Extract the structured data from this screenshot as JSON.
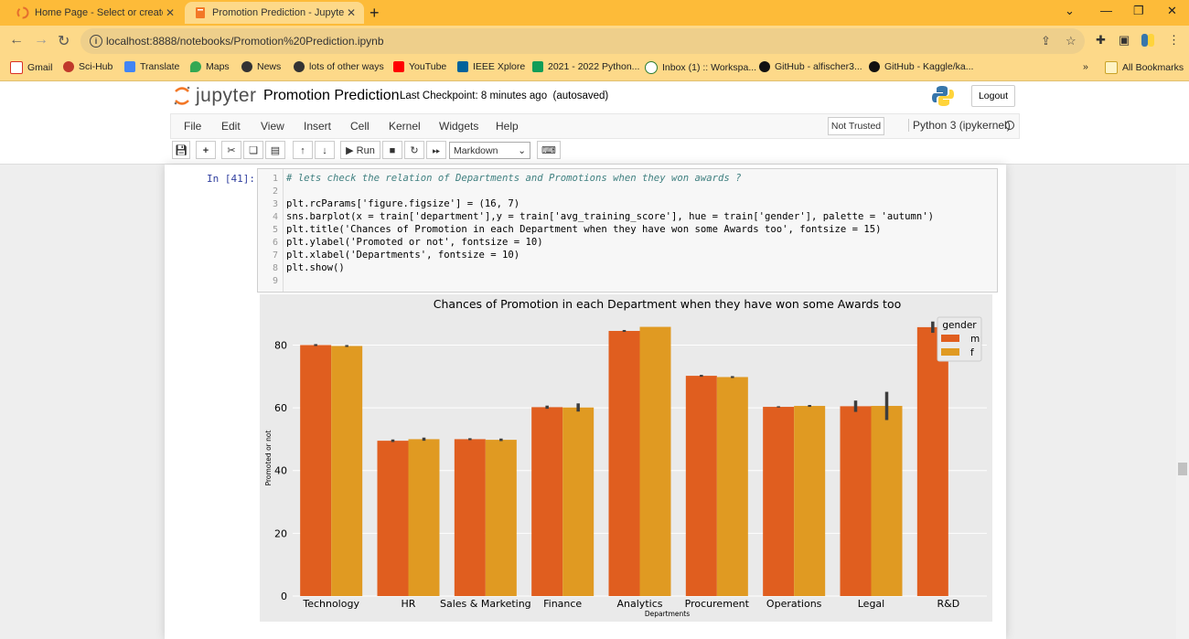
{
  "browser": {
    "tabs": [
      {
        "title": "Home Page - Select or create a n",
        "active": false
      },
      {
        "title": "Promotion Prediction - Jupyter N",
        "active": true
      }
    ],
    "url": "localhost:8888/notebooks/Promotion%20Prediction.ipynb",
    "bookmarks": [
      "Gmail",
      "Sci-Hub",
      "Translate",
      "Maps",
      "News",
      "lots of other ways",
      "YouTube",
      "IEEE Xplore",
      "2021 - 2022 Python...",
      "Inbox (1) :: Workspa...",
      "GitHub - alfischer3...",
      "GitHub - Kaggle/ka..."
    ],
    "all_bookmarks": "All Bookmarks",
    "overflow": "»"
  },
  "jupyter": {
    "logo": "jupyter",
    "notebook_name": "Promotion Prediction",
    "checkpoint": "Last Checkpoint: 8 minutes ago",
    "autosaved": "(autosaved)",
    "logout": "Logout",
    "menu": [
      "File",
      "Edit",
      "View",
      "Insert",
      "Cell",
      "Kernel",
      "Widgets",
      "Help"
    ],
    "not_trusted": "Not Trusted",
    "kernel": "Python 3 (ipykernel)",
    "run_label": "Run",
    "cell_type": "Markdown"
  },
  "cell": {
    "prompt": "In [41]:",
    "line_numbers": [
      "1",
      "2",
      "3",
      "4",
      "5",
      "6",
      "7",
      "8",
      "9"
    ],
    "lines": [
      "# lets check the relation of Departments and Promotions when they won awards ?",
      "",
      "plt.rcParams['figure.figsize'] = (16, 7)",
      "sns.barplot(x = train['department'],y = train['avg_training_score'], hue = train['gender'], palette = 'autumn')",
      "plt.title('Chances of Promotion in each Department when they have won some Awards too', fontsize = 15)",
      "plt.ylabel('Promoted or not', fontsize = 10)",
      "plt.xlabel('Departments', fontsize = 10)",
      "plt.show()",
      ""
    ]
  },
  "chart_data": {
    "type": "bar",
    "title": "Chances of Promotion in each Department when they have won some Awards too",
    "xlabel": "Departments",
    "ylabel": "Promoted or not",
    "categories": [
      "Technology",
      "HR",
      "Sales & Marketing",
      "Finance",
      "Analytics",
      "Procurement",
      "Operations",
      "Legal",
      "R&D"
    ],
    "series": [
      {
        "name": "m",
        "color": "#e05e1f",
        "values": [
          80.0,
          49.5,
          50.0,
          60.2,
          84.5,
          70.2,
          60.3,
          60.5,
          85.7
        ],
        "err": [
          0.3,
          0.4,
          0.3,
          0.5,
          0.3,
          0.3,
          0.2,
          1.8,
          1.8
        ]
      },
      {
        "name": "f",
        "color": "#e09a22",
        "values": [
          79.7,
          50.0,
          49.8,
          60.1,
          85.8,
          69.8,
          60.6,
          60.6,
          null
        ],
        "err": [
          0.3,
          0.5,
          0.4,
          1.3,
          0.0,
          0.3,
          0.3,
          4.5,
          0
        ]
      }
    ],
    "yticks": [
      0,
      20,
      40,
      60,
      80
    ],
    "ylim": [
      0,
      88
    ],
    "legend_title": "gender",
    "legend_position": "top-right",
    "grid": true
  }
}
